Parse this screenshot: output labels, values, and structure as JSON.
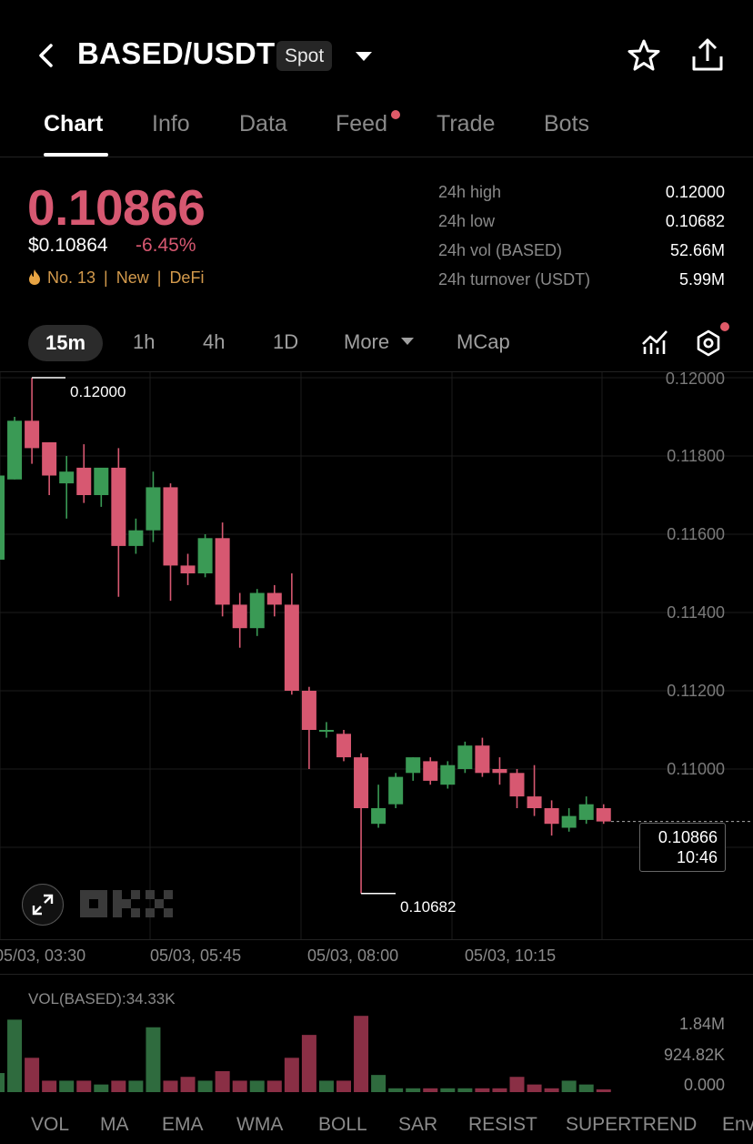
{
  "header": {
    "pair": "BASED/USDT",
    "market_type": "Spot"
  },
  "tabs": [
    {
      "label": "Chart",
      "active": true
    },
    {
      "label": "Info"
    },
    {
      "label": "Data"
    },
    {
      "label": "Feed",
      "notify": true
    },
    {
      "label": "Trade"
    },
    {
      "label": "Bots"
    }
  ],
  "price": {
    "last": "0.10866",
    "usd": "$0.10864",
    "change": "-6.45%",
    "rank": "No. 13",
    "tag_new": "New",
    "tag_sector": "DeFi",
    "sep": "|"
  },
  "stats": [
    {
      "label": "24h high",
      "value": "0.12000"
    },
    {
      "label": "24h low",
      "value": "0.10682"
    },
    {
      "label": "24h vol (BASED)",
      "value": "52.66M"
    },
    {
      "label": "24h turnover (USDT)",
      "value": "5.99M"
    }
  ],
  "timeframes": [
    "15m",
    "1h",
    "4h",
    "1D",
    "More",
    "MCap"
  ],
  "chart": {
    "y_labels": [
      "0.12000",
      "0.11800",
      "0.11600",
      "0.11400",
      "0.11200",
      "0.11000"
    ],
    "x_labels": [
      "05/03, 03:30",
      "05/03, 05:45",
      "05/03, 08:00",
      "05/03, 10:15"
    ],
    "high_marker": "0.12000",
    "low_marker": "0.10682",
    "last_price": "0.10866",
    "countdown": "10:46",
    "watermark": "OKX"
  },
  "volume": {
    "title": "VOL(BASED):34.33K",
    "y_labels": [
      "1.84M",
      "924.82K",
      "0.000"
    ]
  },
  "indicators": [
    "VOL",
    "MA",
    "EMA",
    "WMA",
    "BOLL",
    "SAR",
    "RESIST",
    "SUPERTREND",
    "Env"
  ],
  "colors": {
    "up": "#3a9a55",
    "down": "#d75871",
    "accent_orange": "#d39a4c"
  },
  "chart_data": {
    "type": "candlestick",
    "ylim": [
      0.106,
      0.1206
    ],
    "candles": [
      {
        "o": 0.11535,
        "h": 0.1184,
        "l": 0.1153,
        "c": 0.1175
      },
      {
        "o": 0.1174,
        "h": 0.119,
        "l": 0.1174,
        "c": 0.1189
      },
      {
        "o": 0.1189,
        "h": 0.12,
        "l": 0.1178,
        "c": 0.1182
      },
      {
        "o": 0.11835,
        "h": 0.11835,
        "l": 0.117,
        "c": 0.1175
      },
      {
        "o": 0.1173,
        "h": 0.118,
        "l": 0.1164,
        "c": 0.1176
      },
      {
        "o": 0.1177,
        "h": 0.1183,
        "l": 0.1168,
        "c": 0.117
      },
      {
        "o": 0.117,
        "h": 0.1172,
        "l": 0.1167,
        "c": 0.1177
      },
      {
        "o": 0.1177,
        "h": 0.1182,
        "l": 0.1144,
        "c": 0.1157
      },
      {
        "o": 0.1157,
        "h": 0.1164,
        "l": 0.1155,
        "c": 0.1161
      },
      {
        "o": 0.1161,
        "h": 0.1176,
        "l": 0.1158,
        "c": 0.1172
      },
      {
        "o": 0.1172,
        "h": 0.1173,
        "l": 0.1143,
        "c": 0.1152
      },
      {
        "o": 0.1152,
        "h": 0.1155,
        "l": 0.1147,
        "c": 0.115
      },
      {
        "o": 0.115,
        "h": 0.116,
        "l": 0.1149,
        "c": 0.1159
      },
      {
        "o": 0.1159,
        "h": 0.1163,
        "l": 0.1139,
        "c": 0.1142
      },
      {
        "o": 0.1142,
        "h": 0.1145,
        "l": 0.1131,
        "c": 0.1136
      },
      {
        "o": 0.1136,
        "h": 0.1146,
        "l": 0.1134,
        "c": 0.1145
      },
      {
        "o": 0.1145,
        "h": 0.1147,
        "l": 0.1139,
        "c": 0.1142
      },
      {
        "o": 0.1142,
        "h": 0.115,
        "l": 0.1119,
        "c": 0.112
      },
      {
        "o": 0.112,
        "h": 0.1121,
        "l": 0.11,
        "c": 0.111
      },
      {
        "o": 0.111,
        "h": 0.1112,
        "l": 0.1108,
        "c": 0.111
      },
      {
        "o": 0.1109,
        "h": 0.111,
        "l": 0.1102,
        "c": 0.1103
      },
      {
        "o": 0.1103,
        "h": 0.1104,
        "l": 0.10682,
        "c": 0.109
      },
      {
        "o": 0.1086,
        "h": 0.1096,
        "l": 0.1085,
        "c": 0.109
      },
      {
        "o": 0.1091,
        "h": 0.1099,
        "l": 0.109,
        "c": 0.1098
      },
      {
        "o": 0.1099,
        "h": 0.1103,
        "l": 0.1097,
        "c": 0.1103
      },
      {
        "o": 0.1102,
        "h": 0.1103,
        "l": 0.1096,
        "c": 0.1097
      },
      {
        "o": 0.1096,
        "h": 0.1102,
        "l": 0.1095,
        "c": 0.1101
      },
      {
        "o": 0.11,
        "h": 0.1107,
        "l": 0.1099,
        "c": 0.1106
      },
      {
        "o": 0.1106,
        "h": 0.1108,
        "l": 0.1098,
        "c": 0.1099
      },
      {
        "o": 0.11,
        "h": 0.1103,
        "l": 0.1096,
        "c": 0.1099
      },
      {
        "o": 0.1099,
        "h": 0.11,
        "l": 0.109,
        "c": 0.1093
      },
      {
        "o": 0.1093,
        "h": 0.1101,
        "l": 0.1088,
        "c": 0.109
      },
      {
        "o": 0.109,
        "h": 0.1092,
        "l": 0.1083,
        "c": 0.1086
      },
      {
        "o": 0.1085,
        "h": 0.109,
        "l": 0.1084,
        "c": 0.1088
      },
      {
        "o": 0.1087,
        "h": 0.1093,
        "l": 0.1086,
        "c": 0.1091
      },
      {
        "o": 0.109,
        "h": 0.1091,
        "l": 0.1086,
        "c": 0.10866
      }
    ],
    "volume": {
      "max": 2.1,
      "values_m": [
        0.5,
        1.9,
        0.9,
        0.3,
        0.3,
        0.3,
        0.2,
        0.3,
        0.3,
        1.7,
        0.3,
        0.4,
        0.3,
        0.55,
        0.3,
        0.3,
        0.3,
        0.9,
        1.5,
        0.3,
        0.3,
        2.0,
        0.45,
        0.1,
        0.1,
        0.1,
        0.1,
        0.1,
        0.1,
        0.1,
        0.4,
        0.2,
        0.1,
        0.3,
        0.2,
        0.05
      ]
    }
  }
}
